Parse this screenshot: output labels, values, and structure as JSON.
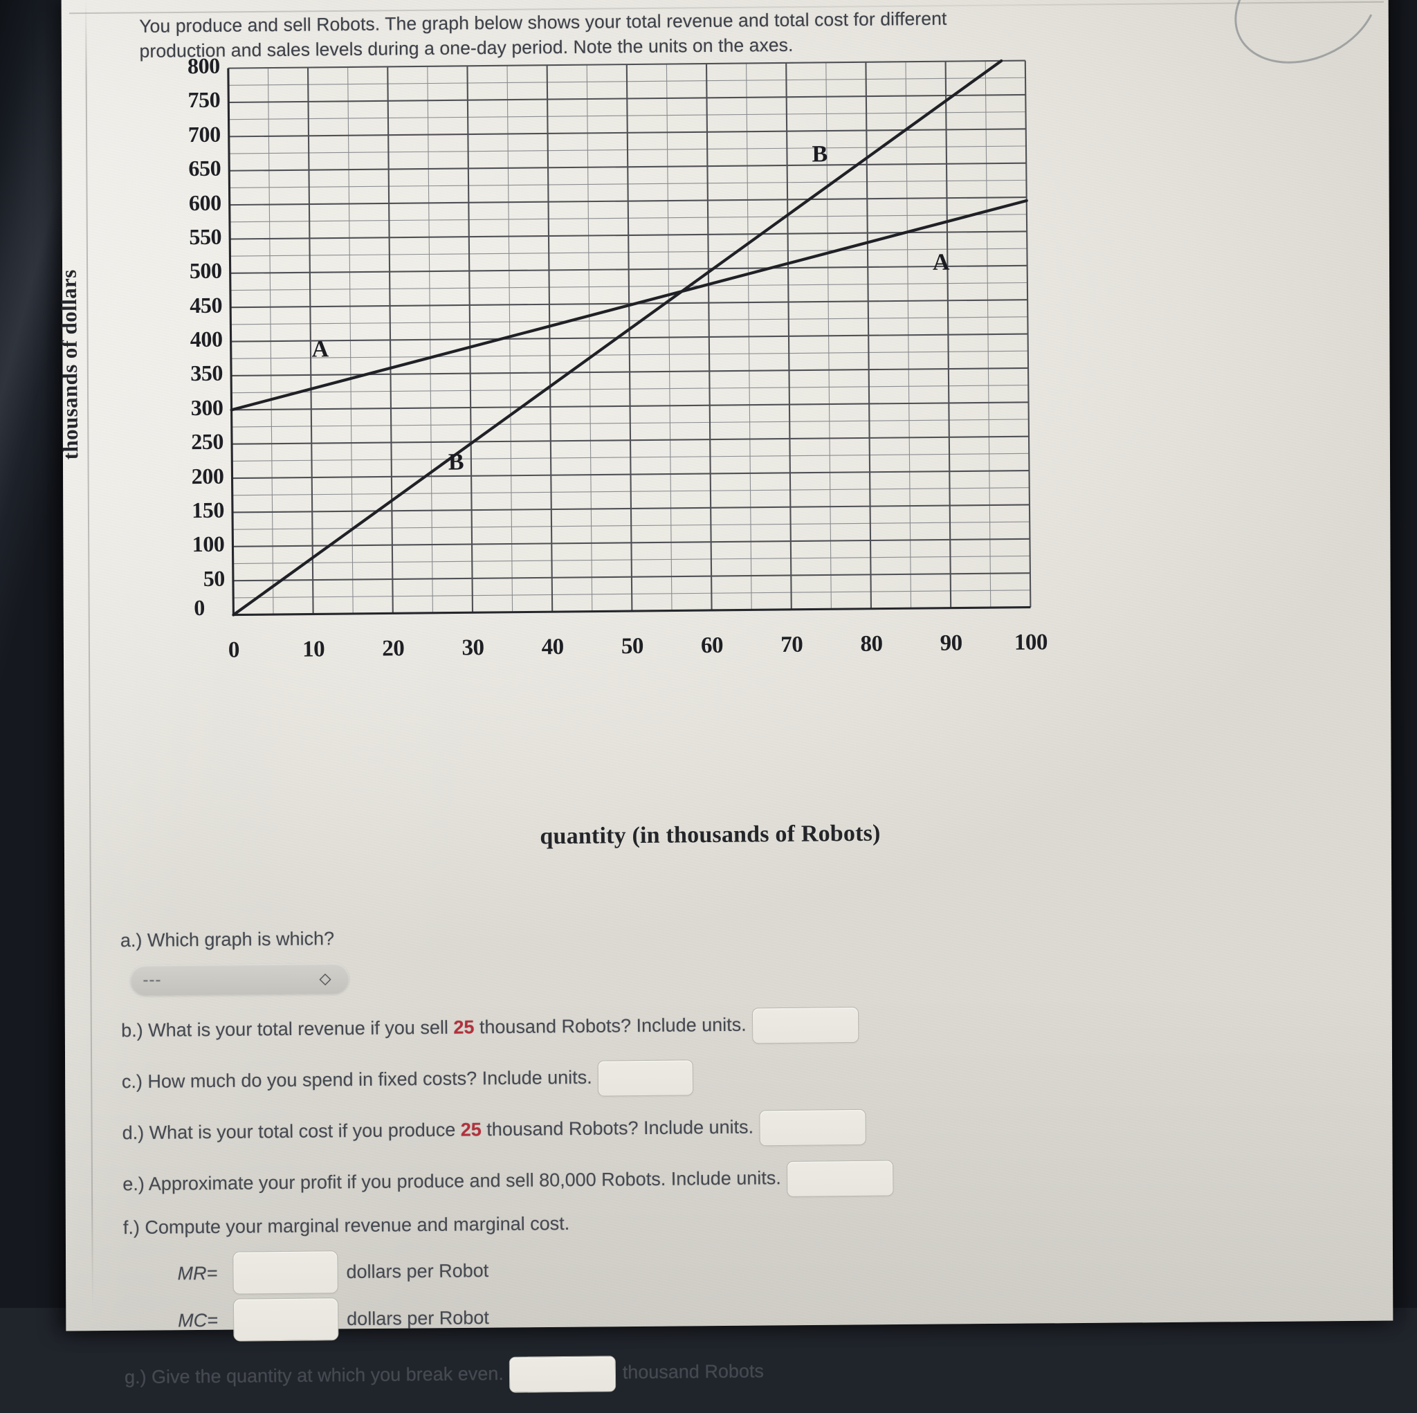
{
  "prompt": {
    "text": "You produce and sell Robots. The graph below shows your total revenue and total cost for different production and sales levels during a one-day period. Note the units on the axes."
  },
  "chart_data": {
    "type": "line",
    "title": "",
    "xlabel": "quantity (in thousands of Robots)",
    "ylabel": "thousands of dollars",
    "xlim": [
      0,
      100
    ],
    "ylim": [
      0,
      800
    ],
    "xticks": [
      "0",
      "10",
      "20",
      "30",
      "40",
      "50",
      "60",
      "70",
      "80",
      "90",
      "100"
    ],
    "yticks": [
      "0",
      "50",
      "100",
      "150",
      "200",
      "250",
      "300",
      "350",
      "400",
      "450",
      "500",
      "550",
      "600",
      "650",
      "700",
      "750",
      "800"
    ],
    "grid": true,
    "minor_grid_x_step": 5,
    "minor_grid_y_step": 25,
    "legend": "inline-labels",
    "series": [
      {
        "name": "A",
        "points": [
          [
            0,
            300
          ],
          [
            100,
            595
          ]
        ],
        "slope": 2.95,
        "intercept": 300,
        "labels": [
          {
            "text": "A",
            "x": 11,
            "y": 382
          },
          {
            "text": "A",
            "x": 89,
            "y": 500
          }
        ]
      },
      {
        "name": "B",
        "points": [
          [
            0,
            0
          ],
          [
            97,
            800
          ]
        ],
        "slope": 8.25,
        "intercept": 0,
        "labels": [
          {
            "text": "B",
            "x": 28,
            "y": 215
          },
          {
            "text": "B",
            "x": 74,
            "y": 660
          }
        ]
      }
    ]
  },
  "questions": [
    {
      "id": "a",
      "label": "a.) Which graph is which?",
      "control": "dropdown",
      "dropdown_value": "---",
      "caret": "chevron-updown-icon"
    },
    {
      "id": "b",
      "pre": "b.) What is your total revenue if you sell ",
      "num": "25",
      "post": " thousand Robots? Include units.",
      "answer": ""
    },
    {
      "id": "c",
      "pre": "c.) How much do you spend in fixed costs? Include units.",
      "num": "",
      "post": "",
      "answer": ""
    },
    {
      "id": "d",
      "pre": "d.) What is your total cost if you produce ",
      "num": "25",
      "post": " thousand Robots? Include units.",
      "answer": ""
    },
    {
      "id": "e",
      "pre": "e.) Approximate your profit if you produce and sell 80,000 Robots. Include units.",
      "num": "",
      "post": "",
      "answer": ""
    },
    {
      "id": "f",
      "pre": "f.) Compute your marginal revenue and marginal cost.",
      "num": "",
      "post": "",
      "answer": ""
    }
  ],
  "marginal": {
    "mr_symbol": "MR=",
    "mr_value": "",
    "mr_unit": "dollars per Robot",
    "mc_symbol": "MC=",
    "mc_value": "",
    "mc_unit": "dollars per Robot"
  },
  "question_g": {
    "pre": "g.) Give the quantity at which you break even.",
    "value": "",
    "unit": "thousand Robots"
  },
  "colors": {
    "paper": "#ece9e2",
    "ink": "#454951",
    "highlight_number": "#b3303c",
    "grid": "#5a5c61",
    "curve": "#1f2126"
  }
}
